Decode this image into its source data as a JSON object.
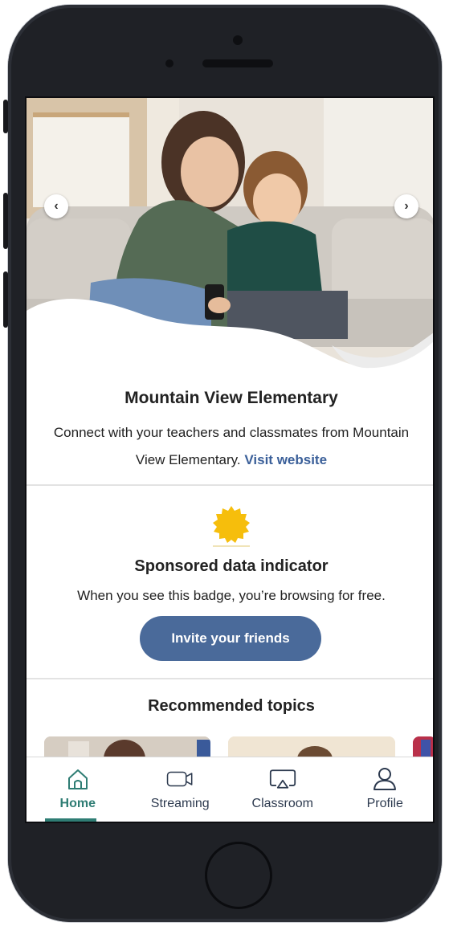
{
  "hero": {
    "prev_icon": "chevron-left-icon",
    "next_icon": "chevron-right-icon"
  },
  "school": {
    "title": "Mountain View Elementary",
    "description": "Connect with your teachers and classmates from Mountain View Elementary.",
    "link_label": "Visit website"
  },
  "sponsored": {
    "badge_icon": "sponsored-badge-icon",
    "badge_color": "#f6be0c",
    "title": "Sponsored data indicator",
    "description": "When you see this badge, you’re browsing for free."
  },
  "invite": {
    "label": "Invite your friends",
    "color": "#4a6a9a"
  },
  "topics": {
    "title": "Recommended topics"
  },
  "tabs": [
    {
      "label": "Home",
      "icon": "home-icon",
      "active": true
    },
    {
      "label": "Streaming",
      "icon": "video-camera-icon",
      "active": false
    },
    {
      "label": "Classroom",
      "icon": "screen-cast-icon",
      "active": false
    },
    {
      "label": "Profile",
      "icon": "person-icon",
      "active": false
    }
  ],
  "colors": {
    "accent": "#2f7d74",
    "link": "#3a5f99"
  }
}
